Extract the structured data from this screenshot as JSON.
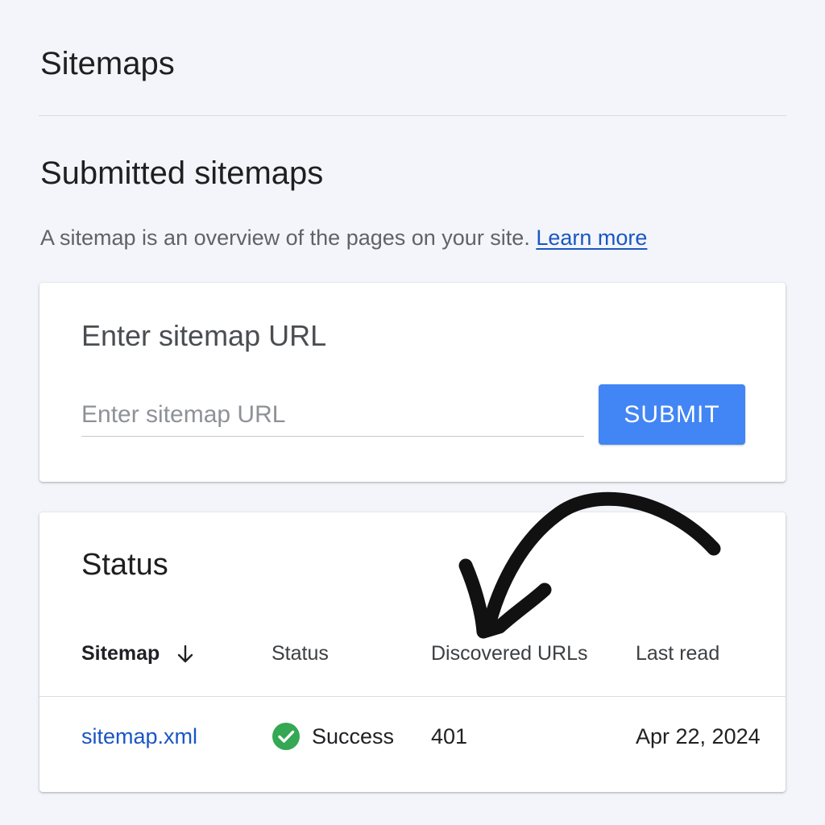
{
  "header": {
    "title": "Sitemaps"
  },
  "submitted": {
    "title": "Submitted sitemaps",
    "description": "A sitemap is an overview of the pages on your site.",
    "learn_more": "Learn more"
  },
  "submit_card": {
    "title": "Enter sitemap URL",
    "input_placeholder": "Enter sitemap URL",
    "input_value": "",
    "submit_label": "SUBMIT"
  },
  "status_card": {
    "title": "Status",
    "columns": [
      "Sitemap",
      "Status",
      "Discovered URLs",
      "Last read"
    ],
    "rows": [
      {
        "sitemap": "sitemap.xml",
        "status": "Success",
        "discovered_urls": "401",
        "last_read": "Apr 22, 2024"
      }
    ]
  },
  "icons": {
    "sort": "arrow-down-icon",
    "status_success": "check-circle-icon",
    "annotation": "curved-arrow-icon"
  },
  "colors": {
    "accent": "#4285f4",
    "link": "#1a56c4",
    "success": "#34a853",
    "background": "#f3f5fa"
  }
}
